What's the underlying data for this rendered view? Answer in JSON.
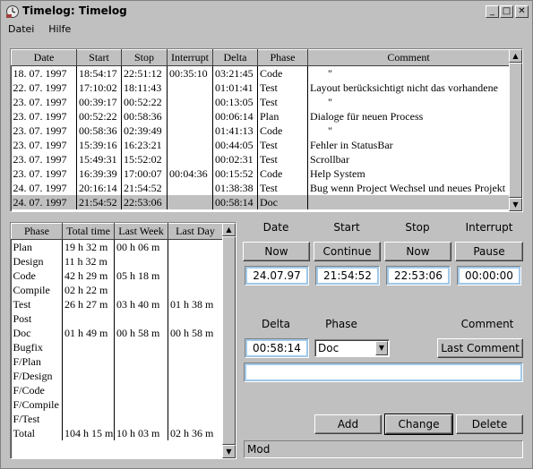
{
  "window": {
    "title": "Timelog: Timelog",
    "controls": {
      "minimize": "_",
      "maximize": "□",
      "close": "✕"
    }
  },
  "menu": [
    "Datei",
    "Hilfe"
  ],
  "log_table": {
    "columns": [
      "Date",
      "Start",
      "Stop",
      "Interrupt",
      "Delta",
      "Phase",
      "Comment"
    ],
    "rows": [
      [
        "18. 07. 1997",
        "18:54:17",
        "22:51:12",
        "00:35:10",
        "03:21:45",
        "Code",
        "\""
      ],
      [
        "22. 07. 1997",
        "17:10:02",
        "18:11:43",
        "",
        "01:01:41",
        "Test",
        "Layout berücksichtigt nicht das vorhandene"
      ],
      [
        "23. 07. 1997",
        "00:39:17",
        "00:52:22",
        "",
        "00:13:05",
        "Test",
        "\""
      ],
      [
        "23. 07. 1997",
        "00:52:22",
        "00:58:36",
        "",
        "00:06:14",
        "Plan",
        "Dialoge für neuen Process"
      ],
      [
        "23. 07. 1997",
        "00:58:36",
        "02:39:49",
        "",
        "01:41:13",
        "Code",
        "\""
      ],
      [
        "23. 07. 1997",
        "15:39:16",
        "16:23:21",
        "",
        "00:44:05",
        "Test",
        "Fehler in StatusBar"
      ],
      [
        "23. 07. 1997",
        "15:49:31",
        "15:52:02",
        "",
        "00:02:31",
        "Test",
        "Scrollbar"
      ],
      [
        "23. 07. 1997",
        "16:39:39",
        "17:00:07",
        "00:04:36",
        "00:15:52",
        "Code",
        "Help System"
      ],
      [
        "24. 07. 1997",
        "20:16:14",
        "21:54:52",
        "",
        "01:38:38",
        "Test",
        "Bug wenn Project Wechsel und neues Projekt"
      ],
      [
        "24. 07. 1997",
        "21:54:52",
        "22:53:06",
        "",
        "00:58:14",
        "Doc",
        ""
      ]
    ],
    "selected_row": 9
  },
  "summary_table": {
    "columns": [
      "Phase",
      "Total time",
      "Last Week",
      "Last Day"
    ],
    "rows": [
      [
        "Plan",
        "19 h 32 m",
        "00 h 06 m",
        ""
      ],
      [
        "Design",
        "11 h 32 m",
        "",
        ""
      ],
      [
        "Code",
        "42 h 29 m",
        "05 h 18 m",
        ""
      ],
      [
        "Compile",
        "02 h 22 m",
        "",
        ""
      ],
      [
        "Test",
        "26 h 27 m",
        "03 h 40 m",
        "01 h 38 m"
      ],
      [
        "Post",
        "",
        "",
        ""
      ],
      [
        "Doc",
        "01 h 49 m",
        "00 h 58 m",
        "00 h 58 m"
      ],
      [
        "Bugfix",
        "",
        "",
        ""
      ],
      [
        "F/Plan",
        "",
        "",
        ""
      ],
      [
        "F/Design",
        "",
        "",
        ""
      ],
      [
        "F/Code",
        "",
        "",
        ""
      ],
      [
        "F/Compile",
        "",
        "",
        ""
      ],
      [
        "F/Test",
        "",
        "",
        ""
      ],
      [
        "Total",
        "104 h 15 m",
        "10 h 03 m",
        "02 h 36 m"
      ]
    ]
  },
  "editor": {
    "labels": {
      "date": "Date",
      "start": "Start",
      "stop": "Stop",
      "interrupt": "Interrupt",
      "delta": "Delta",
      "phase": "Phase",
      "comment": "Comment"
    },
    "buttons": {
      "date_now": "Now",
      "start_continue": "Continue",
      "stop_now": "Now",
      "pause": "Pause",
      "last_comment": "Last Comment",
      "add": "Add",
      "change": "Change",
      "delete": "Delete"
    },
    "values": {
      "date": "24.07.97",
      "start": "21:54:52",
      "stop": "22:53:06",
      "interrupt": "00:00:00",
      "delta": "00:58:14",
      "phase": "Doc",
      "comment": ""
    }
  },
  "status": "Mod"
}
